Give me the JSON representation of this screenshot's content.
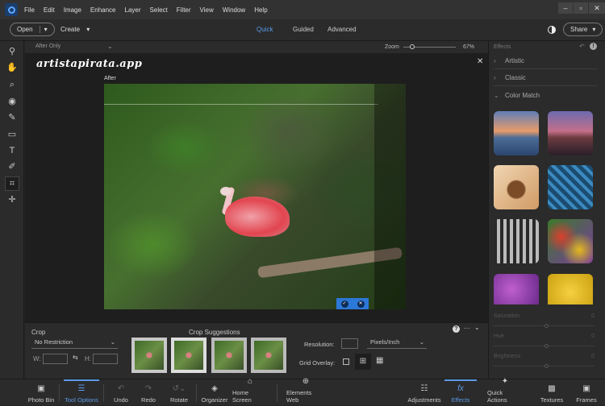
{
  "menubar": {
    "items": [
      "File",
      "Edit",
      "Image",
      "Enhance",
      "Layer",
      "Select",
      "Filter",
      "View",
      "Window",
      "Help"
    ]
  },
  "toolbar": {
    "open": "Open",
    "create": "Create",
    "modes": [
      "Quick",
      "Guided",
      "Advanced"
    ],
    "active_mode": "Quick",
    "share": "Share"
  },
  "viewbar": {
    "view": "After Only",
    "zoom_label": "Zoom",
    "zoom_value": "67%",
    "zoom_fraction": 0.08
  },
  "canvas": {
    "watermark": "artistapirata.app",
    "after_label": "After"
  },
  "effects": {
    "title": "Effects",
    "sections": [
      {
        "label": "Artistic",
        "expanded": false
      },
      {
        "label": "Classic",
        "expanded": false
      },
      {
        "label": "Color Match",
        "expanded": true
      }
    ],
    "sliders": [
      {
        "label": "Saturation",
        "value": "0"
      },
      {
        "label": "Hue",
        "value": "0"
      },
      {
        "label": "Brightness",
        "value": "0"
      }
    ]
  },
  "options": {
    "crop_label": "Crop",
    "preset": "No Restriction",
    "w_label": "W:",
    "h_label": "H:",
    "suggestions_label": "Crop Suggestions",
    "resolution_label": "Resolution:",
    "resolution_unit": "Pixels/Inch",
    "grid_label": "Grid Overlay:"
  },
  "bottombar": {
    "left": [
      "Photo Bin",
      "Tool Options",
      "Undo",
      "Redo",
      "Rotate",
      "Organizer",
      "Home Screen",
      "Elements Web"
    ],
    "right": [
      "Adjustments",
      "Effects",
      "Quick Actions",
      "Textures",
      "Frames"
    ]
  },
  "colors": {
    "accent": "#5b9ae8",
    "crop_confirm": "#2c78d8"
  }
}
